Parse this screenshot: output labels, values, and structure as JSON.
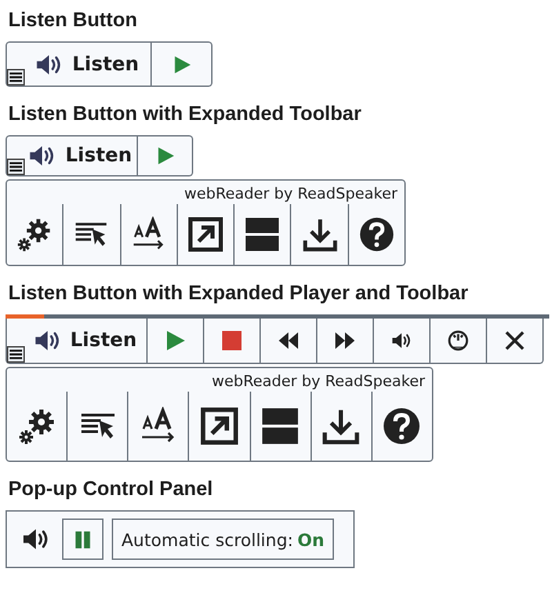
{
  "sections": [
    {
      "kind": "listen",
      "title": "Listen Button",
      "listen": {
        "label": "Listen"
      }
    },
    {
      "kind": "listen_toolbar",
      "title": "Listen Button with Expanded Toolbar",
      "listen": {
        "label": "Listen"
      },
      "toolbar": {
        "brand": "webReader by ReadSpeaker"
      }
    },
    {
      "kind": "player_toolbar",
      "title": "Listen Button with Expanded Player and Toolbar",
      "listen": {
        "label": "Listen"
      },
      "progress": {
        "level": 0.07
      },
      "toolbar": {
        "brand": "webReader by ReadSpeaker"
      }
    },
    {
      "kind": "popup",
      "title": "Pop-up Control Panel",
      "scrolling": {
        "label": "Automatic scrolling:",
        "value": "On"
      }
    }
  ]
}
